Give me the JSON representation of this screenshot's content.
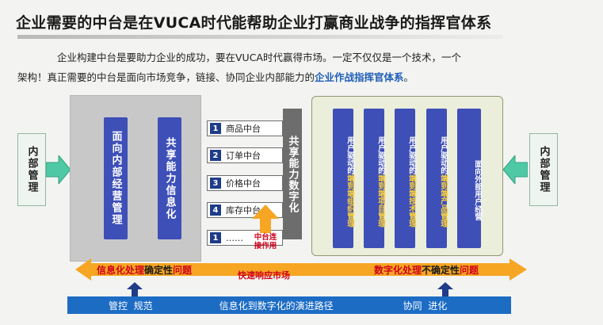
{
  "title": "企业需要的中台是在VUCA时代能帮助企业打赢商业战争的指挥官体系",
  "intro": {
    "line1": "企业构建中台是要助力企业的成功，要在VUCA时代赢得市场。一定不仅仅是一个技术，一个",
    "line2_prefix": "架构！真正需要的中台是面向市场竞争，链接、协同企业内部能力的",
    "line2_highlight": "企业作战指挥官体系",
    "line2_suffix": "。"
  },
  "left_side_label": "内部管理",
  "right_side_label": "内部管理",
  "left_panel": {
    "col1": "面向内部经营管理",
    "col2": "共享能力信息化"
  },
  "middle_items": [
    {
      "num": "1",
      "label": "商品中台"
    },
    {
      "num": "2",
      "label": "订单中台"
    },
    {
      "num": "3",
      "label": "价格中台"
    },
    {
      "num": "4",
      "label": "库存中台"
    },
    {
      "num": "1",
      "label": "……"
    }
  ],
  "shared_column": "共享能力数字化",
  "middle_annotation": "中台连接作用",
  "right_panel": {
    "cols": [
      {
        "top": "用户驱动的",
        "bottom": "端到端组织管理"
      },
      {
        "top": "用户驱动的",
        "bottom": "端到端项目管理"
      },
      {
        "top": "用户驱动的",
        "bottom": "端到端技术管理"
      },
      {
        "top": "用户驱动的",
        "bottom": "端到端产品管理"
      },
      {
        "top": "面向外部用户经营",
        "bottom": ""
      }
    ]
  },
  "left_arrow_text": {
    "a": "信息化处理",
    "b": "确定性",
    "c": "问题"
  },
  "right_arrow_text": {
    "a": "数字化处理",
    "b": "不确定性",
    "c": "问题"
  },
  "center_arrow_text": "快速响应市场",
  "bottom_bar": {
    "left": "管控  规范",
    "center": "信息化到数字化的演进路径",
    "right": "协同  进化"
  },
  "colors": {
    "navy": "#3e4fb8",
    "orange": "#f6a623",
    "red_text": "#d0021b",
    "green_arrow": "#4fc8a5",
    "blue_bar": "#1c6cc4"
  }
}
